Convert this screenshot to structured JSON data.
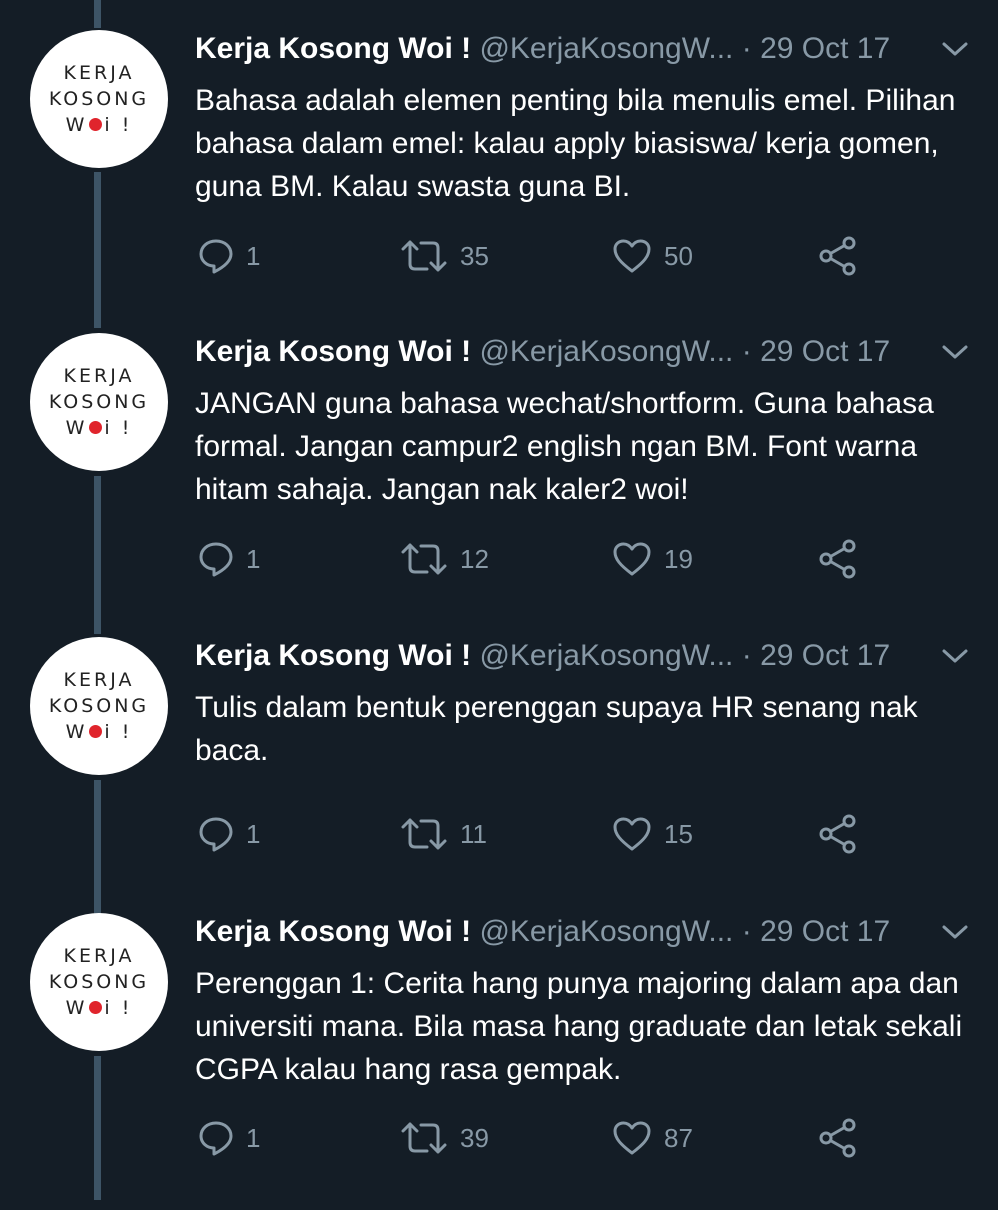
{
  "avatar": {
    "line1": "KERJA",
    "line2": "KOSONG",
    "line3a": "W",
    "line3b": "i !"
  },
  "tweets": [
    {
      "name": "Kerja Kosong Woi !",
      "handle": "@KerjaKosongW...",
      "separator": "·",
      "date": "29 Oct 17",
      "text": "Bahasa adalah elemen penting bila menulis emel. Pilihan bahasa dalam emel: kalau apply biasiswa/ kerja gomen, guna BM. Kalau swasta guna BI.",
      "replies": "1",
      "retweets": "35",
      "likes": "50"
    },
    {
      "name": "Kerja Kosong Woi !",
      "handle": "@KerjaKosongW...",
      "separator": "·",
      "date": "29 Oct 17",
      "text": "JANGAN guna bahasa wechat/shortform. Guna bahasa formal. Jangan campur2 english ngan BM. Font warna hitam sahaja. Jangan nak kaler2 woi!",
      "replies": "1",
      "retweets": "12",
      "likes": "19"
    },
    {
      "name": "Kerja Kosong Woi !",
      "handle": "@KerjaKosongW...",
      "separator": "·",
      "date": "29 Oct 17",
      "text": "Tulis dalam bentuk perenggan supaya HR senang nak baca.",
      "replies": "1",
      "retweets": "11",
      "likes": "15"
    },
    {
      "name": "Kerja Kosong Woi !",
      "handle": "@KerjaKosongW...",
      "separator": "·",
      "date": "29 Oct 17",
      "text": "Perenggan 1: Cerita hang punya majoring dalam apa dan universiti mana. Bila masa hang graduate dan letak sekali CGPA kalau hang rasa gempak.",
      "replies": "1",
      "retweets": "39",
      "likes": "87"
    }
  ],
  "colors": {
    "background": "#141d26",
    "thread_line": "#3d5466",
    "secondary_text": "#8899a6",
    "logo_red": "#e0242c"
  }
}
